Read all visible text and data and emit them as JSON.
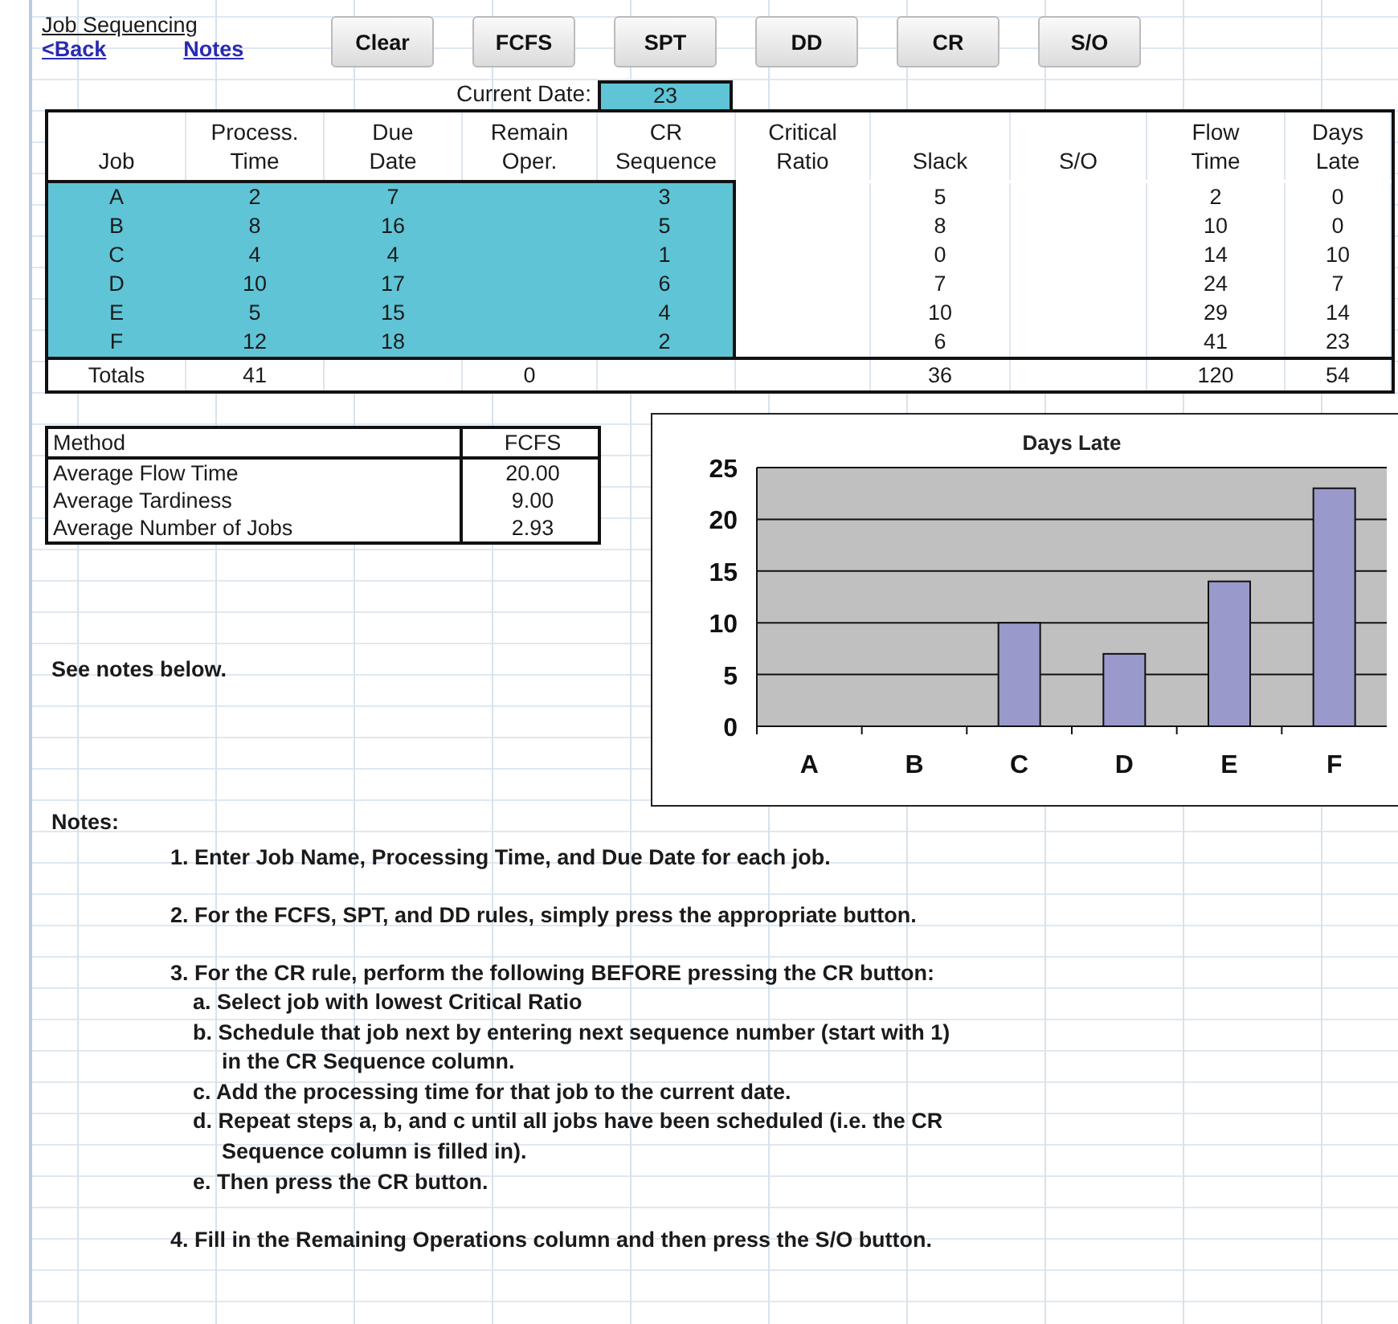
{
  "header": {
    "title": "Job Sequencing",
    "links": [
      {
        "label": "<Back"
      },
      {
        "label": "Notes"
      }
    ]
  },
  "buttons": [
    "Clear",
    "FCFS",
    "SPT",
    "DD",
    "CR",
    "S/O"
  ],
  "current_date": {
    "label": "Current Date:",
    "value": "23"
  },
  "table": {
    "columns": [
      {
        "lines": [
          "Job"
        ],
        "input": true
      },
      {
        "lines": [
          "Process.",
          "Time"
        ],
        "input": true
      },
      {
        "lines": [
          "Due",
          "Date"
        ],
        "input": true
      },
      {
        "lines": [
          "Remain",
          "Oper."
        ],
        "input": true
      },
      {
        "lines": [
          "CR",
          "Sequence"
        ],
        "input": true
      },
      {
        "lines": [
          "Critical",
          "Ratio"
        ],
        "input": false
      },
      {
        "lines": [
          "Slack"
        ],
        "input": false
      },
      {
        "lines": [
          "S/O"
        ],
        "input": false
      },
      {
        "lines": [
          "Flow",
          "Time"
        ],
        "input": false
      },
      {
        "lines": [
          "Days",
          "Late"
        ],
        "input": false
      }
    ],
    "rows": [
      [
        "A",
        "2",
        "7",
        null,
        "3",
        null,
        "5",
        null,
        "2",
        "0"
      ],
      [
        "B",
        "8",
        "16",
        null,
        "5",
        null,
        "8",
        null,
        "10",
        "0"
      ],
      [
        "C",
        "4",
        "4",
        null,
        "1",
        null,
        "0",
        null,
        "14",
        "10"
      ],
      [
        "D",
        "10",
        "17",
        null,
        "6",
        null,
        "7",
        null,
        "24",
        "7"
      ],
      [
        "E",
        "5",
        "15",
        null,
        "4",
        null,
        "10",
        null,
        "29",
        "14"
      ],
      [
        "F",
        "12",
        "18",
        null,
        "2",
        null,
        "6",
        null,
        "41",
        "23"
      ]
    ],
    "totals": {
      "column_1": "Totals",
      "column_2": "41",
      "column_4": "0",
      "column_7": "36",
      "column_9": "120",
      "column_10": "54"
    }
  },
  "summary": {
    "columns": [
      "Method",
      "FCFS"
    ],
    "rows": [
      [
        "Average Flow Time",
        "20.00"
      ],
      [
        "Average Tardiness",
        "9.00"
      ],
      [
        "Average Number of Jobs",
        "2.93"
      ]
    ]
  },
  "see_notes": "See notes below.",
  "chart": {
    "chart_data": {
      "type": "bar",
      "title": "Days Late",
      "categories": [
        "A",
        "B",
        "C",
        "D",
        "E",
        "F"
      ],
      "values": [
        0,
        0,
        10,
        7,
        14,
        23
      ],
      "ylim": [
        0,
        25
      ],
      "grid": true,
      "yticks": [
        0,
        5,
        10,
        15,
        20,
        25
      ]
    }
  },
  "notes": {
    "title": "Notes:",
    "items": [
      {
        "text": "1. Enter Job Name, Processing Time, and Due Date for each job."
      },
      {
        "text": "2. For the FCFS, SPT, and DD rules, simply press the appropriate button."
      },
      {
        "text": "3. For the CR rule, perform the following BEFORE pressing the CR button:",
        "children": [
          {
            "text": "a. Select job with lowest Critical Ratio"
          },
          {
            "text": "b. Schedule that job next by entering next sequence number (start with 1) in the CR Sequence column."
          },
          {
            "text": "c. Add the processing time for that job to the current date."
          },
          {
            "text": "d. Repeat steps a, b, and c until all jobs have been scheduled (i.e. the CR Sequence column is filled in)."
          },
          {
            "text": "e. Then press the CR button."
          }
        ]
      },
      {
        "text": "4. Fill in the Remaining Operations column and then press the S/O button."
      }
    ]
  }
}
